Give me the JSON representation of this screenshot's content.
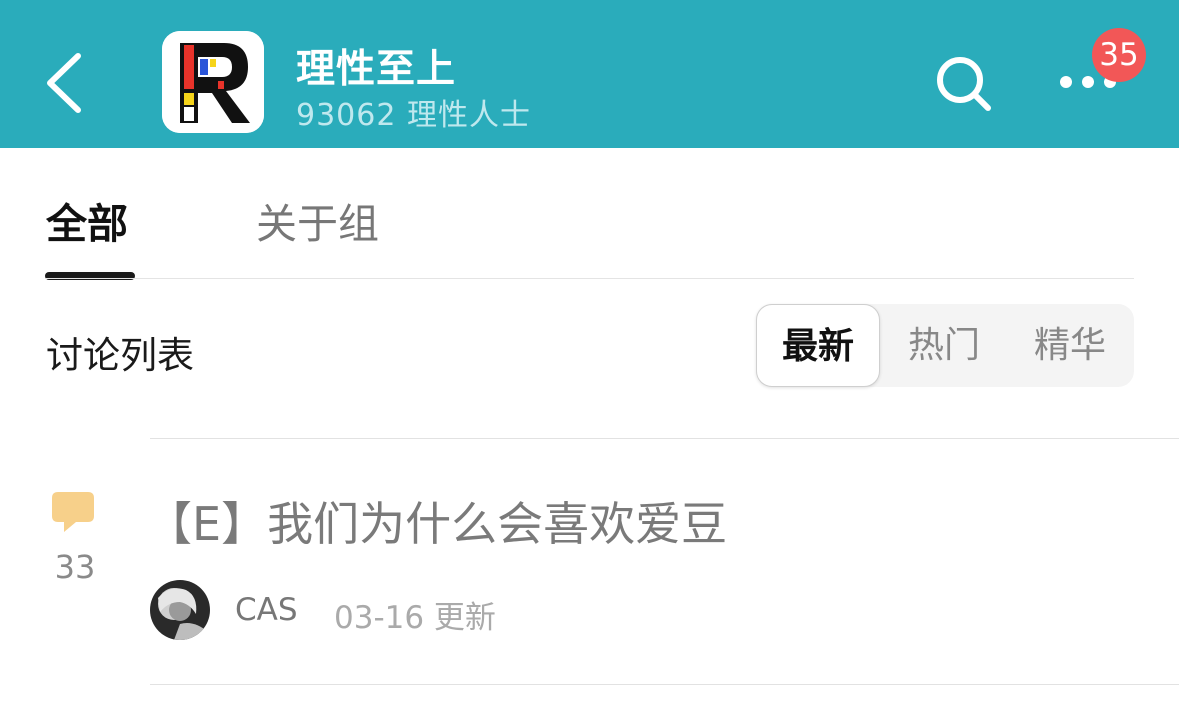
{
  "header": {
    "title": "理性至上",
    "subtitle": "93062 理性人士",
    "badge_count": "35",
    "icons": [
      "back-arrow-icon",
      "group-logo",
      "search-icon",
      "more-dots-icon"
    ],
    "background_color": "#2aacbb"
  },
  "tabs": [
    {
      "label": "全部",
      "active": true
    },
    {
      "label": "关于组",
      "active": false
    }
  ],
  "section": {
    "title": "讨论列表",
    "sort_options": [
      {
        "label": "最新",
        "active": true
      },
      {
        "label": "热门",
        "active": false
      },
      {
        "label": "精华",
        "active": false
      }
    ]
  },
  "posts": [
    {
      "title": "【E】我们为什么会喜欢爱豆",
      "comment_count": "33",
      "author": "CAS",
      "updated": "03-16 更新",
      "comment_icon": "comment-bubble-icon"
    }
  ],
  "colors": {
    "accent": "#2aacbb",
    "badge": "#f25757",
    "comment_icon": "#f7d08a"
  }
}
